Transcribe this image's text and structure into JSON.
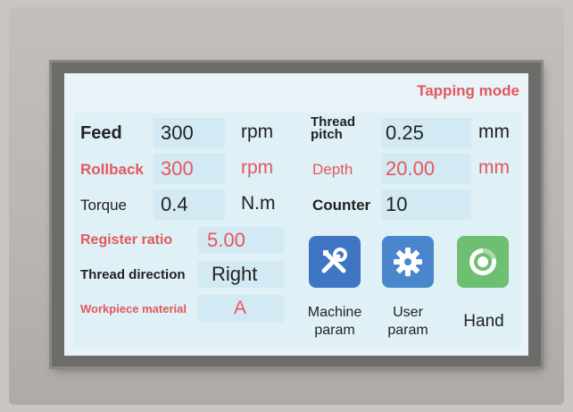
{
  "header": {
    "mode": "Tapping mode"
  },
  "params": {
    "feed": {
      "label": "Feed",
      "value": "300",
      "unit": "rpm"
    },
    "rollback": {
      "label": "Rollback",
      "value": "300",
      "unit": "rpm"
    },
    "torque": {
      "label": "Torque",
      "value": "0.4",
      "unit": "N.m"
    },
    "thread_pitch": {
      "label_line1": "Thread",
      "label_line2": "pitch",
      "value": "0.25",
      "unit": "mm"
    },
    "depth": {
      "label": "Depth",
      "value": "20.00",
      "unit": "mm"
    },
    "counter": {
      "label": "Counter",
      "value": "10"
    },
    "register_ratio": {
      "label": "Register ratio",
      "value": "5.00"
    },
    "thread_direction": {
      "label": "Thread direction",
      "value": "Right"
    },
    "workpiece_material": {
      "label": "Workpiece material",
      "value": "A"
    }
  },
  "buttons": {
    "machine": {
      "line1": "Machine",
      "line2": "param",
      "icon": "tools-icon"
    },
    "user": {
      "line1": "User",
      "line2": "param",
      "icon": "gear-icon"
    },
    "hand": {
      "label": "Hand",
      "icon": "hand-mode-icon"
    }
  },
  "colors": {
    "accent_red": "#e2585c",
    "screen_bg": "#e9f3f8",
    "machine_btn": "#3f76c4",
    "user_btn": "#4a86cc",
    "hand_btn": "#6fbf73"
  }
}
